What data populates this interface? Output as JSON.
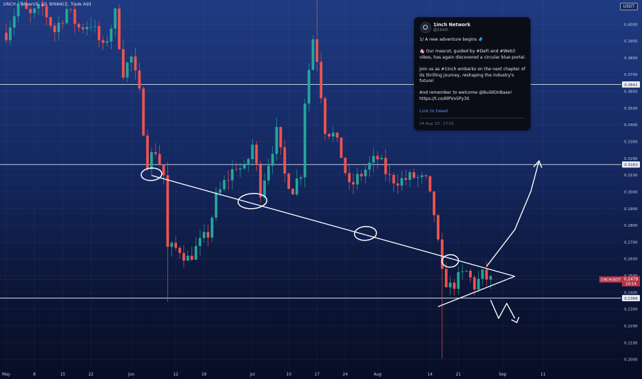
{
  "chart_data": {
    "type": "candlestick",
    "symbol_title": "1INCH / TetherUS, 1D, BINANCE, Trade Add",
    "currency": "USDT",
    "x_axis_labels": [
      {
        "label": "May",
        "date": "2023-05-01"
      },
      {
        "label": "8",
        "date": "2023-05-08"
      },
      {
        "label": "15",
        "date": "2023-05-15"
      },
      {
        "label": "22",
        "date": "2023-05-22"
      },
      {
        "label": "Jun",
        "date": "2023-06-01"
      },
      {
        "label": "12",
        "date": "2023-06-12"
      },
      {
        "label": "19",
        "date": "2023-06-19"
      },
      {
        "label": "Jul",
        "date": "2023-07-01"
      },
      {
        "label": "10",
        "date": "2023-07-10"
      },
      {
        "label": "17",
        "date": "2023-07-17"
      },
      {
        "label": "24",
        "date": "2023-07-24"
      },
      {
        "label": "Aug",
        "date": "2023-08-01"
      },
      {
        "label": "14",
        "date": "2023-08-14"
      },
      {
        "label": "21",
        "date": "2023-08-21"
      },
      {
        "label": "Sep",
        "date": "2023-09-01"
      },
      {
        "label": "11",
        "date": "2023-09-11"
      }
    ],
    "y_ticks": [
      "0.4000",
      "0.3900",
      "0.3800",
      "0.3700",
      "0.3600",
      "0.3500",
      "0.3400",
      "0.3300",
      "0.3200",
      "0.3100",
      "0.3000",
      "0.2900",
      "0.2800",
      "0.2700",
      "0.2600",
      "0.2500",
      "0.2400",
      "0.2300",
      "0.2200",
      "0.2100",
      "0.2000"
    ],
    "ylim": [
      0.1945,
      0.4145
    ],
    "horizontal_levels": [
      {
        "value": 0.3641,
        "label": "0.3641"
      },
      {
        "value": 0.3163,
        "label": "0.3163"
      },
      {
        "value": 0.2366,
        "label": "0.2366"
      }
    ],
    "current_price": {
      "value": 0.2479,
      "pair_label": "1INCHUSDT",
      "price_label": "0.2479",
      "countdown": "10:14"
    },
    "path": [
      {
        "date": "2023-05-01",
        "price": 0.395
      },
      {
        "date": "2023-05-04",
        "price": 0.412
      },
      {
        "date": "2023-05-07",
        "price": 0.405
      },
      {
        "date": "2023-05-10",
        "price": 0.41
      },
      {
        "date": "2023-05-13",
        "price": 0.396
      },
      {
        "date": "2023-05-16",
        "price": 0.409
      },
      {
        "date": "2023-05-19",
        "price": 0.398
      },
      {
        "date": "2023-05-22",
        "price": 0.401
      },
      {
        "date": "2023-05-25",
        "price": 0.385
      },
      {
        "date": "2023-05-28",
        "price": 0.406
      },
      {
        "date": "2023-05-30",
        "price": 0.372
      },
      {
        "date": "2023-06-01",
        "price": 0.38
      },
      {
        "date": "2023-06-03",
        "price": 0.358
      },
      {
        "date": "2023-06-05",
        "price": 0.318
      },
      {
        "date": "2023-06-07",
        "price": 0.325
      },
      {
        "date": "2023-06-09",
        "price": 0.31
      },
      {
        "date": "2023-06-10",
        "price": 0.266
      },
      {
        "date": "2023-06-13",
        "price": 0.266
      },
      {
        "date": "2023-06-15",
        "price": 0.26
      },
      {
        "date": "2023-06-17",
        "price": 0.266
      },
      {
        "date": "2023-06-20",
        "price": 0.275
      },
      {
        "date": "2023-06-22",
        "price": 0.296
      },
      {
        "date": "2023-06-24",
        "price": 0.305
      },
      {
        "date": "2023-06-27",
        "price": 0.316
      },
      {
        "date": "2023-06-29",
        "price": 0.312
      },
      {
        "date": "2023-07-01",
        "price": 0.328
      },
      {
        "date": "2023-07-03",
        "price": 0.301
      },
      {
        "date": "2023-07-05",
        "price": 0.318
      },
      {
        "date": "2023-07-07",
        "price": 0.335
      },
      {
        "date": "2023-07-09",
        "price": 0.31
      },
      {
        "date": "2023-07-11",
        "price": 0.302
      },
      {
        "date": "2023-07-13",
        "price": 0.312
      },
      {
        "date": "2023-07-14",
        "price": 0.355
      },
      {
        "date": "2023-07-16",
        "price": 0.392
      },
      {
        "date": "2023-07-17",
        "price": 0.38
      },
      {
        "date": "2023-07-19",
        "price": 0.338
      },
      {
        "date": "2023-07-21",
        "price": 0.334
      },
      {
        "date": "2023-07-23",
        "price": 0.322
      },
      {
        "date": "2023-07-25",
        "price": 0.302
      },
      {
        "date": "2023-07-27",
        "price": 0.308
      },
      {
        "date": "2023-07-30",
        "price": 0.316
      },
      {
        "date": "2023-08-01",
        "price": 0.32
      },
      {
        "date": "2023-08-04",
        "price": 0.308
      },
      {
        "date": "2023-08-07",
        "price": 0.307
      },
      {
        "date": "2023-08-10",
        "price": 0.309
      },
      {
        "date": "2023-08-13",
        "price": 0.306
      },
      {
        "date": "2023-08-15",
        "price": 0.287
      },
      {
        "date": "2023-08-16",
        "price": 0.268
      },
      {
        "date": "2023-08-17",
        "price": 0.25
      },
      {
        "date": "2023-08-19",
        "price": 0.243
      },
      {
        "date": "2023-08-21",
        "price": 0.248
      },
      {
        "date": "2023-08-23",
        "price": 0.252
      },
      {
        "date": "2023-08-25",
        "price": 0.244
      },
      {
        "date": "2023-08-27",
        "price": 0.25
      },
      {
        "date": "2023-08-29",
        "price": 0.247
      }
    ],
    "spikes": [
      {
        "date": "2023-06-10",
        "high": 0.318,
        "low": 0.2345
      },
      {
        "date": "2023-08-17",
        "high": 0.262,
        "low": 0.2005
      },
      {
        "date": "2023-07-17",
        "high": 0.4145,
        "low": 0.372
      }
    ],
    "annotations": {
      "trendline": [
        {
          "date": "2023-06-06",
          "price": 0.3098
        },
        {
          "date": "2023-09-04",
          "price": 0.2496
        }
      ],
      "lower_line": [
        {
          "date": "2023-08-16",
          "price": 0.2315
        },
        {
          "date": "2023-09-04",
          "price": 0.2496
        }
      ],
      "circles": [
        {
          "date": "2023-06-06",
          "price": 0.3105
        },
        {
          "date": "2023-07-01",
          "price": 0.2945
        },
        {
          "date": "2023-07-29",
          "price": 0.2752
        },
        {
          "date": "2023-08-19",
          "price": 0.2588
        }
      ],
      "up_arrow": [
        {
          "date": "2023-08-28",
          "price": 0.2555
        },
        {
          "date": "2023-09-04",
          "price": 0.2775
        },
        {
          "date": "2023-09-08",
          "price": 0.3005
        },
        {
          "date": "2023-09-10",
          "price": 0.3185
        }
      ],
      "down_arrow": [
        {
          "date": "2023-08-29",
          "price": 0.2355
        },
        {
          "date": "2023-08-31",
          "price": 0.2245
        },
        {
          "date": "2023-09-02",
          "price": 0.2335
        },
        {
          "date": "2023-09-04",
          "price": 0.2245
        }
      ]
    }
  },
  "tweet": {
    "name": "1inch Network",
    "handle": "@1inch",
    "lines": [
      "1/ A new adventure begins 🧳",
      "🦄 Our mascot, guided by #DeFi and #Web3 vibes, has again discovered a circular blue portal.",
      "Join us as #1inch embarks on the next chapter of its thrilling journey, reshaping the industry's future!",
      "And remember to welcome @BuildOnBase! https://t.co/6lPVx5Py3S"
    ],
    "link_text": "Link to tweet",
    "timestamp": "24 Aug '23 · 17:02"
  },
  "colors": {
    "bg_top": "#1f3b82",
    "bg_bottom": "#070d24",
    "candle_up": "#26a69a",
    "candle_down": "#ef5350",
    "annotation": "#ffffff",
    "price_badge": "#b5364a"
  }
}
